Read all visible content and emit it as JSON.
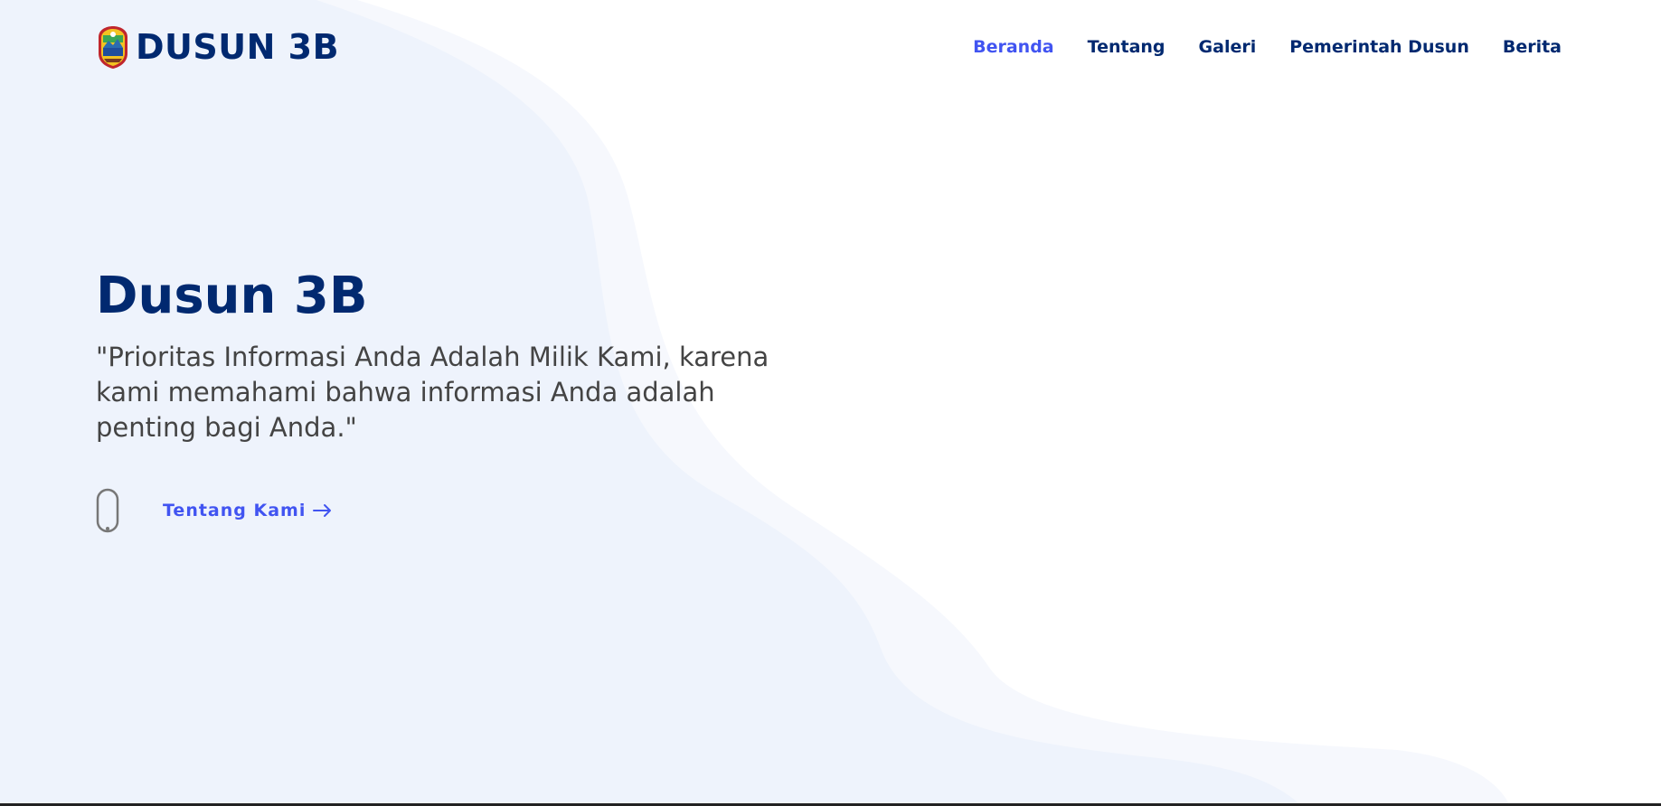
{
  "brand": {
    "title": "DUSUN 3B",
    "logo_icon": "village-emblem-icon"
  },
  "nav": {
    "items": [
      {
        "label": "Beranda",
        "active": true
      },
      {
        "label": "Tentang",
        "active": false
      },
      {
        "label": "Galeri",
        "active": false
      },
      {
        "label": "Pemerintah Dusun",
        "active": false
      },
      {
        "label": "Berita",
        "active": false
      }
    ]
  },
  "hero": {
    "title": "Dusun 3B",
    "subtitle": "\"Prioritas Informasi Anda Adalah Milik Kami, karena kami memahami bahwa informasi Anda adalah penting bagi Anda.\"",
    "cta_label": "Tentang Kami",
    "cta_icon": "arrow-right-icon",
    "scroll_icon": "mouse-scroll-icon"
  },
  "colors": {
    "primary": "#012970",
    "accent": "#4154f1",
    "text": "#444444",
    "wave_dark": "#eef3fc",
    "wave_light": "#f6f8fd",
    "background": "#ffffff"
  }
}
